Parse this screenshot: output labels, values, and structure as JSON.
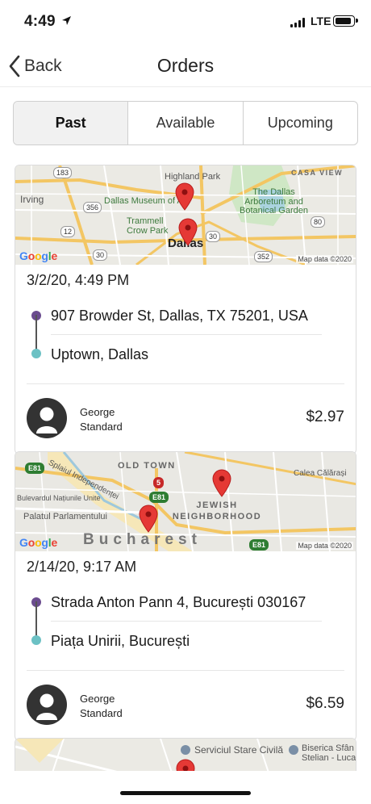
{
  "status_bar": {
    "time": "4:49",
    "network": "LTE"
  },
  "nav": {
    "back_label": "Back",
    "title": "Orders"
  },
  "tabs": [
    {
      "label": "Past",
      "active": true
    },
    {
      "label": "Available",
      "active": false
    },
    {
      "label": "Upcoming",
      "active": false
    }
  ],
  "orders": [
    {
      "map": {
        "labels": {
          "highland_park": "Highland Park",
          "casa_view": "CASA VIEW",
          "irving": "Irving",
          "museum": "Dallas Museum of Art",
          "arboretum": "The Dallas Arboretum and Botanical Garden",
          "trammell": "Trammell Crow Park",
          "city": "Dallas"
        },
        "shields": [
          "183",
          "356",
          "12",
          "30",
          "80",
          "352",
          "30"
        ],
        "logo": "Google",
        "attribution": "Map data ©2020"
      },
      "date": "3/2/20, 4:49 PM",
      "pickup": "907 Browder St, Dallas, TX 75201, USA",
      "dropoff": "Uptown, Dallas",
      "driver_name": "George",
      "driver_tier": "Standard",
      "price": "$2.97"
    },
    {
      "map": {
        "labels": {
          "old_town": "OLD TOWN",
          "calea": "Calea Călărași",
          "splaiul": "Splaiul Independenței",
          "bulevardul": "Bulevardul Națiunile Unite",
          "palatul": "Palatul Parlamentului",
          "jewish": "JEWISH NEIGHBORHOOD",
          "city": "Bucharest"
        },
        "shields": [
          "E81",
          "5",
          "E81",
          "E81"
        ],
        "logo": "Google",
        "attribution": "Map data ©2020"
      },
      "date": "2/14/20, 9:17 AM",
      "pickup": "Strada Anton Pann 4, București 030167",
      "dropoff": "Piața Unirii, București",
      "driver_name": "George",
      "driver_tier": "Standard",
      "price": "$6.59"
    },
    {
      "map": {
        "labels": {
          "serviciul": "Serviciul Stare Civilă",
          "biserica": "Biserica Sfân Stelian - Luca"
        }
      }
    }
  ],
  "colors": {
    "origin_dot": "#6b4c8f",
    "dest_dot": "#6cc1c4",
    "pin": "#e53935",
    "active_tab_bg": "#f1f1f1"
  },
  "icons": {
    "back": "chevron-left-icon",
    "location": "location-arrow-icon",
    "avatar": "person-icon",
    "pin": "map-pin-icon"
  }
}
